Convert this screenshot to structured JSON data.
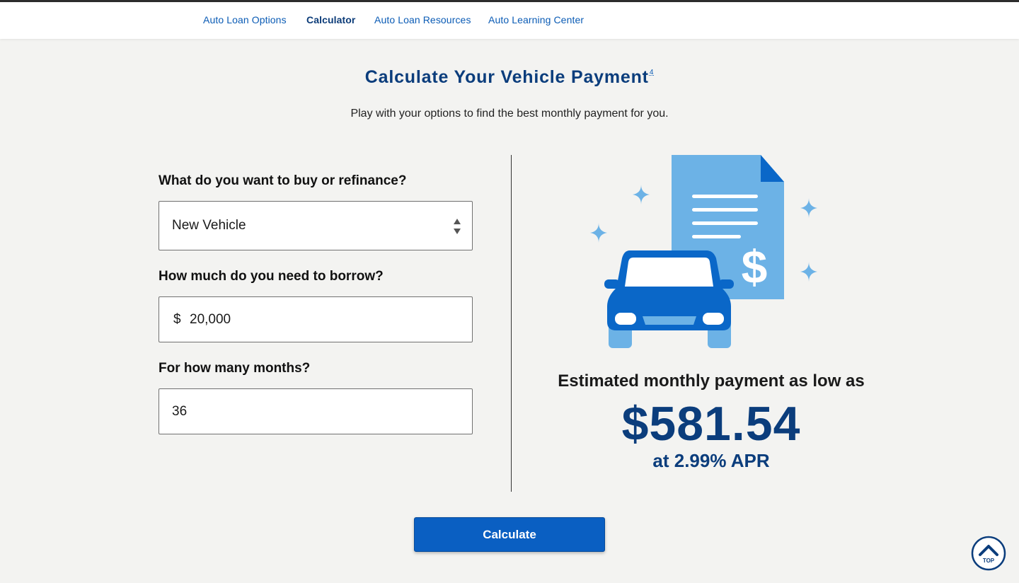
{
  "subnav": {
    "items": [
      {
        "label": "Auto Loan Options"
      },
      {
        "label": "Calculator"
      },
      {
        "label": "Auto Loan Resources"
      },
      {
        "label": "Auto Learning Center"
      }
    ],
    "active": "Calculator"
  },
  "header": {
    "title": "Calculate Your Vehicle Payment",
    "footnote": "4",
    "subtitle": "Play with your options to find the best monthly payment for you."
  },
  "form": {
    "purpose": {
      "label": "What do you want to buy or refinance?",
      "value": "New Vehicle"
    },
    "amount": {
      "label": "How much do you need to borrow?",
      "currency": "$",
      "value": "20,000"
    },
    "months": {
      "label": "For how many months?",
      "value": "36"
    }
  },
  "result": {
    "label": "Estimated monthly payment as low as",
    "amount": "$581.54",
    "apr": "at 2.99% APR"
  },
  "actions": {
    "calculate": "Calculate",
    "top": "TOP"
  },
  "colors": {
    "brand_dark": "#0b3d7c",
    "brand": "#0a5fc2",
    "illustration_light": "#6cb2e6"
  },
  "icons": {
    "illustration": "car-and-dollar-document",
    "back_to_top": "chevron-up-circle-icon"
  }
}
